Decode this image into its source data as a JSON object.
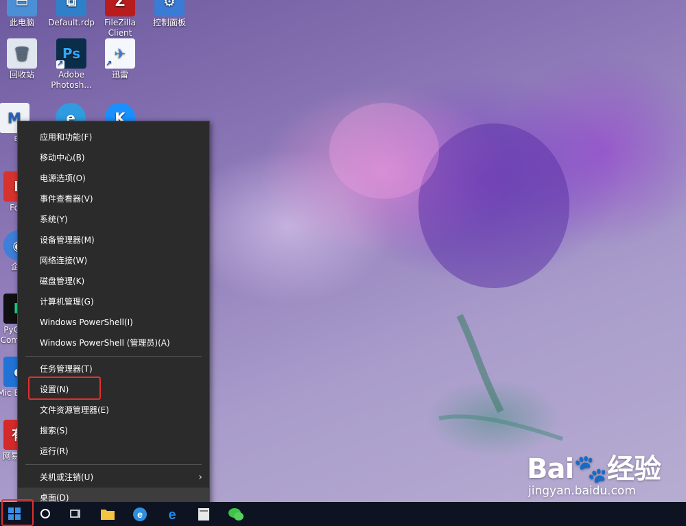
{
  "desktop": {
    "icons": [
      {
        "label": "此电脑"
      },
      {
        "label": "Default.rdp"
      },
      {
        "label": "FileZilla Client"
      },
      {
        "label": "控制面板"
      },
      {
        "label": "回收站"
      },
      {
        "label": "Adobe Photosh..."
      },
      {
        "label": "迅雷"
      },
      {
        "label": "电脑"
      },
      {
        "label": "Fo"
      },
      {
        "label": "企"
      },
      {
        "label": "PyC Com"
      },
      {
        "label": "Mic E"
      },
      {
        "label": "网易"
      }
    ]
  },
  "context_menu": {
    "items": [
      "应用和功能(F)",
      "移动中心(B)",
      "电源选项(O)",
      "事件查看器(V)",
      "系统(Y)",
      "设备管理器(M)",
      "网络连接(W)",
      "磁盘管理(K)",
      "计算机管理(G)",
      "Windows PowerShell(I)",
      "Windows PowerShell (管理员)(A)",
      "任务管理器(T)",
      "设置(N)",
      "文件资源管理器(E)",
      "搜索(S)",
      "运行(R)",
      "关机或注销(U)",
      "桌面(D)"
    ],
    "submenu_arrow": "›"
  },
  "taskbar": {
    "icons": [
      "windows-start-icon",
      "cortana-icon",
      "task-view-icon",
      "file-explorer-icon",
      "edge-icon",
      "ie-icon",
      "app-icon",
      "wechat-icon"
    ]
  },
  "watermark": {
    "brand": "Bai🐾经验",
    "url": "jingyan.baidu.com"
  },
  "colors": {
    "menu_bg": "#2b2b2b",
    "highlight": "#e03030",
    "taskbar_bg": "#0d1320"
  }
}
